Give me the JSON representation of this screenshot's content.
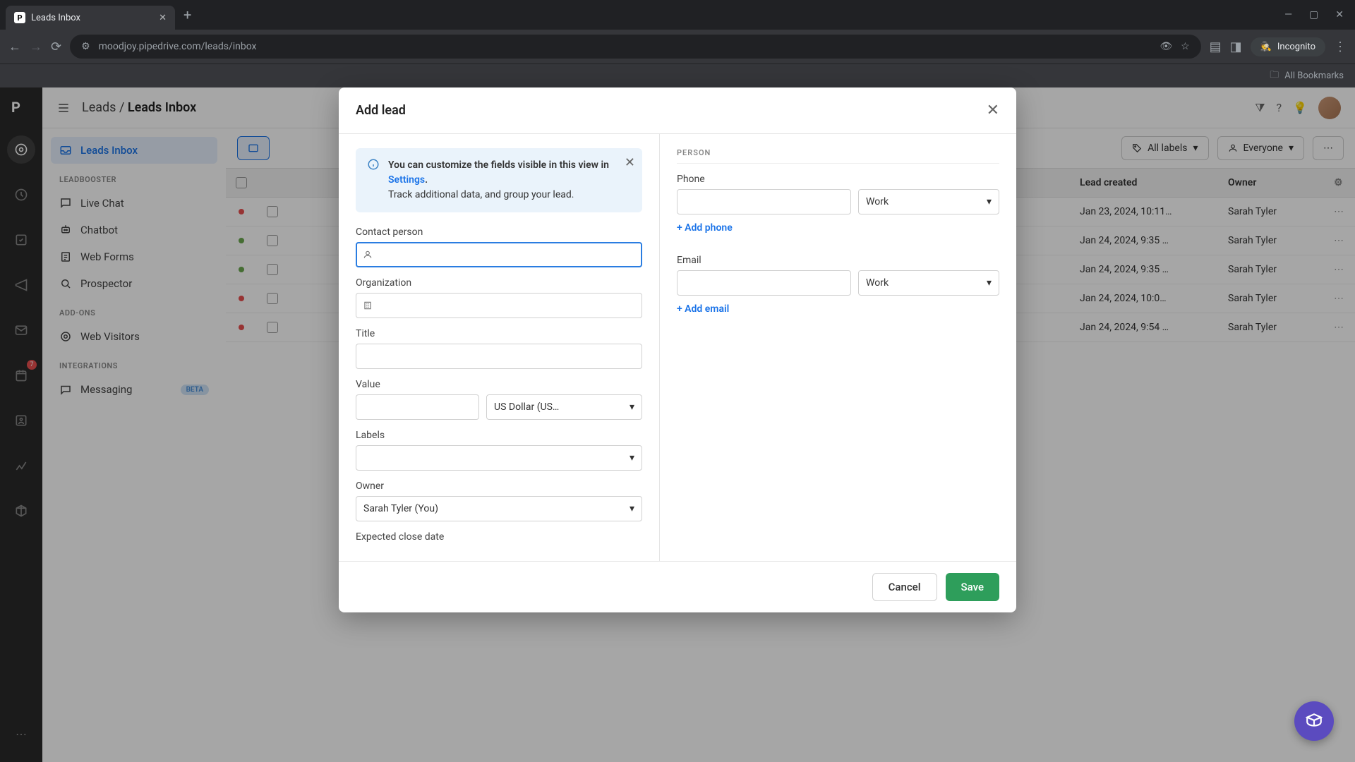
{
  "browser": {
    "tab_title": "Leads Inbox",
    "url": "moodjoy.pipedrive.com/leads/inbox",
    "incognito": "Incognito",
    "bookmarks": "All Bookmarks"
  },
  "breadcrumb": {
    "parent": "Leads",
    "current": "Leads Inbox"
  },
  "sidebar": {
    "inbox": "Leads Inbox",
    "section_leadbooster": "LEADBOOSTER",
    "live_chat": "Live Chat",
    "chatbot": "Chatbot",
    "web_forms": "Web Forms",
    "prospector": "Prospector",
    "section_addons": "ADD-ONS",
    "web_visitors": "Web Visitors",
    "section_integrations": "INTEGRATIONS",
    "messaging": "Messaging",
    "beta": "BETA"
  },
  "rail_badge": "7",
  "filters": {
    "labels": "All labels",
    "everyone": "Everyone"
  },
  "table": {
    "headers": {
      "created": "Lead created",
      "owner": "Owner"
    },
    "rows": [
      {
        "color": "#e84f4f",
        "created": "Jan 23, 2024, 10:11…",
        "owner": "Sarah Tyler"
      },
      {
        "color": "#6aa84f",
        "created": "Jan 24, 2024, 9:35 …",
        "owner": "Sarah Tyler"
      },
      {
        "color": "#6aa84f",
        "created": "Jan 24, 2024, 9:35 …",
        "owner": "Sarah Tyler"
      },
      {
        "color": "#e84f4f",
        "created": "Jan 24, 2024, 10:0…",
        "owner": "Sarah Tyler"
      },
      {
        "color": "#e84f4f",
        "created": "Jan 24, 2024, 9:54 …",
        "owner": "Sarah Tyler"
      }
    ]
  },
  "modal": {
    "title": "Add lead",
    "info1a": "You can customize the fields visible in this view in ",
    "info1b": "Settings",
    "info1c": ".",
    "info2": "Track additional data, and group your lead.",
    "labels": {
      "contact": "Contact person",
      "org": "Organization",
      "title": "Title",
      "value": "Value",
      "labels": "Labels",
      "owner": "Owner",
      "expected": "Expected close date"
    },
    "currency": "US Dollar (US…",
    "owner_value": "Sarah Tyler (You)",
    "right": {
      "section": "PERSON",
      "phone": "Phone",
      "phone_type": "Work",
      "add_phone": "+ Add phone",
      "email": "Email",
      "email_type": "Work",
      "add_email": "+ Add email"
    },
    "cancel": "Cancel",
    "save": "Save"
  }
}
